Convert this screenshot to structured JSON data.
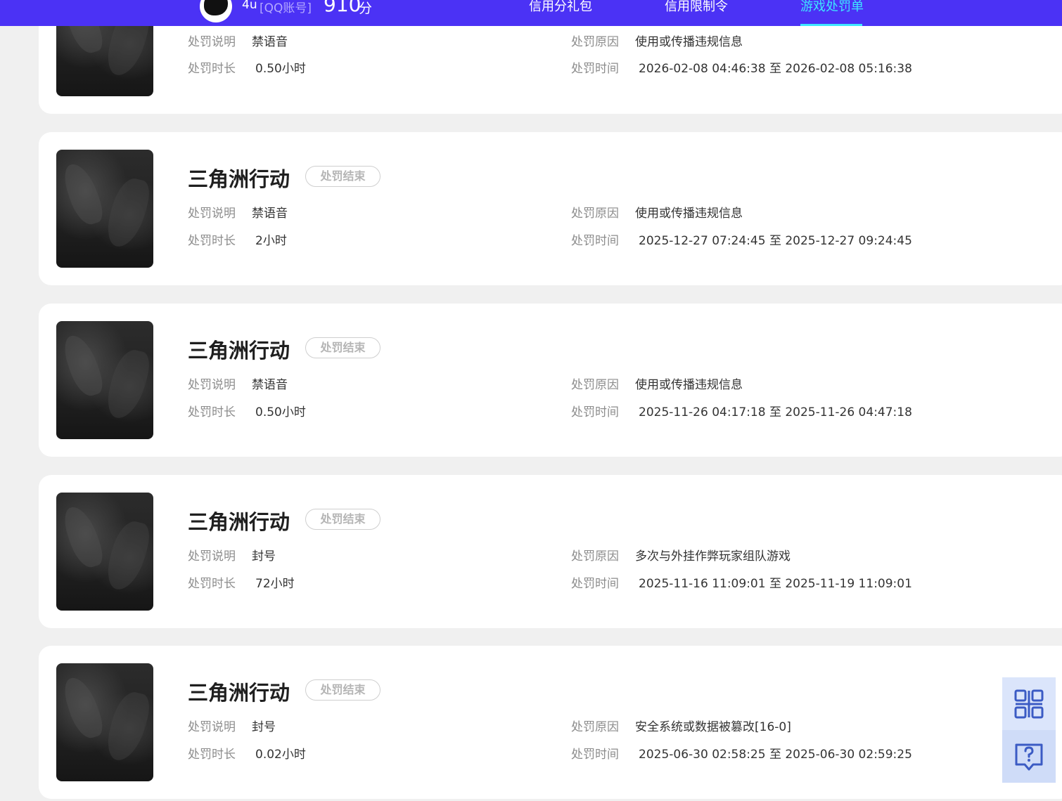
{
  "header": {
    "user_name": "4u",
    "account_type": "[QQ账号]",
    "score": "910",
    "score_unit": "分",
    "nav": [
      {
        "label": "信用分礼包",
        "active": false
      },
      {
        "label": "信用限制令",
        "active": false
      },
      {
        "label": "游戏处罚单",
        "active": true
      }
    ]
  },
  "labels": {
    "desc": "处罚说明",
    "duration": "处罚时长",
    "reason": "处罚原因",
    "time": "处罚时间"
  },
  "records": [
    {
      "game": "",
      "status": "",
      "desc": "禁语音",
      "duration": "0.50小时",
      "reason": "使用或传播违规信息",
      "time": "2026-02-08 04:46:38 至 2026-02-08 05:16:38"
    },
    {
      "game": "三角洲行动",
      "status": "处罚结束",
      "desc": "禁语音",
      "duration": "2小时",
      "reason": "使用或传播违规信息",
      "time": "2025-12-27 07:24:45 至 2025-12-27 09:24:45"
    },
    {
      "game": "三角洲行动",
      "status": "处罚结束",
      "desc": "禁语音",
      "duration": "0.50小时",
      "reason": "使用或传播违规信息",
      "time": "2025-11-26 04:17:18 至 2025-11-26 04:47:18"
    },
    {
      "game": "三角洲行动",
      "status": "处罚结束",
      "desc": "封号",
      "duration": "72小时",
      "reason": "多次与外挂作弊玩家组队游戏",
      "time": "2025-11-16 11:09:01 至 2025-11-19 11:09:01"
    },
    {
      "game": "三角洲行动",
      "status": "处罚结束",
      "desc": "封号",
      "duration": "0.02小时",
      "reason": "安全系统或数据被篡改[16-0]",
      "time": "2025-06-30 02:58:25 至 2025-06-30 02:59:25"
    }
  ],
  "side_tools": [
    {
      "icon": "qr-code-icon"
    },
    {
      "icon": "help-chat-icon"
    }
  ],
  "colors": {
    "header_bg": "#4b32f5",
    "active_nav": "#3ee6ff",
    "page_bg": "#f0f0f0"
  }
}
